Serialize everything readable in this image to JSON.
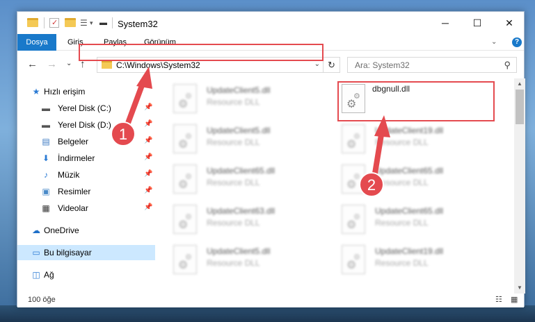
{
  "window": {
    "title": "System32",
    "minimize_glyph": "─",
    "maximize_glyph": "☐",
    "close_glyph": "✕"
  },
  "ribbon": {
    "tabs": [
      "Dosya",
      "Giriş",
      "Paylaş",
      "Görünüm"
    ],
    "chevron_glyph": "⌄",
    "help_glyph": "?"
  },
  "nav": {
    "back_glyph": "←",
    "forward_glyph": "→",
    "recent_glyph": "⌄",
    "up_glyph": "↑",
    "address": "C:\\Windows\\System32",
    "address_dropdown_glyph": "⌄",
    "refresh_glyph": "↻",
    "search_placeholder": "Ara: System32",
    "search_glyph": "⚲"
  },
  "sidebar": {
    "items": [
      {
        "label": "Hızlı erişim",
        "icon": "star-icon",
        "glyph": "★",
        "color": "#2b7bd4",
        "pinned": false
      },
      {
        "label": "Yerel Disk (C:)",
        "icon": "drive-icon",
        "glyph": "▬",
        "color": "#555555",
        "pinned": true
      },
      {
        "label": "Yerel Disk (D:)",
        "icon": "drive-icon",
        "glyph": "▬",
        "color": "#555555",
        "pinned": true
      },
      {
        "label": "Belgeler",
        "icon": "documents-icon",
        "glyph": "▤",
        "color": "#3a78c2",
        "pinned": true
      },
      {
        "label": "İndirmeler",
        "icon": "download-icon",
        "glyph": "⬇",
        "color": "#2b7bd4",
        "pinned": true
      },
      {
        "label": "Müzik",
        "icon": "music-icon",
        "glyph": "♪",
        "color": "#2b7bd4",
        "pinned": true
      },
      {
        "label": "Resimler",
        "icon": "pictures-icon",
        "glyph": "▣",
        "color": "#4a8ac8",
        "pinned": true
      },
      {
        "label": "Videolar",
        "icon": "videos-icon",
        "glyph": "▦",
        "color": "#333333",
        "pinned": true
      },
      {
        "label": "OneDrive",
        "icon": "cloud-icon",
        "glyph": "☁",
        "color": "#1e6fc8",
        "pinned": false
      },
      {
        "label": "Bu bilgisayar",
        "icon": "computer-icon",
        "glyph": "▭",
        "color": "#2b7bd4",
        "pinned": false
      },
      {
        "label": "Ağ",
        "icon": "network-icon",
        "glyph": "◫",
        "color": "#2b7bd4",
        "pinned": false
      }
    ],
    "pin_glyph": "📌"
  },
  "files": [
    {
      "name": "UpdateClient5.dll",
      "type": "Resource DLL",
      "blurred": true
    },
    {
      "name": "dbgnull.dll",
      "type": "",
      "blurred": false
    },
    {
      "name": "UpdateClient5.dll",
      "type": "Resource DLL",
      "blurred": true
    },
    {
      "name": "UpdateClient19.dll",
      "type": "Resource DLL",
      "blurred": true
    },
    {
      "name": "UpdateClient65.dll",
      "type": "Resource DLL",
      "blurred": true
    },
    {
      "name": "UpdateClient65.dll",
      "type": "Resource DLL",
      "blurred": true
    },
    {
      "name": "UpdateClient63.dll",
      "type": "Resource DLL",
      "blurred": true
    },
    {
      "name": "UpdateClient65.dll",
      "type": "Resource DLL",
      "blurred": true
    },
    {
      "name": "UpdateClient5.dll",
      "type": "Resource DLL",
      "blurred": true
    },
    {
      "name": "UpdateClient19.dll",
      "type": "Resource DLL",
      "blurred": true
    }
  ],
  "status": {
    "item_count": "100 öğe"
  },
  "annotations": {
    "step1": "1",
    "step2": "2",
    "color": "#e44a4f"
  },
  "scroll_glyphs": {
    "up": "▲",
    "down": "▼"
  },
  "gear_glyph": "⚙",
  "view_glyphs": {
    "details": "☷",
    "tiles": "▦"
  }
}
